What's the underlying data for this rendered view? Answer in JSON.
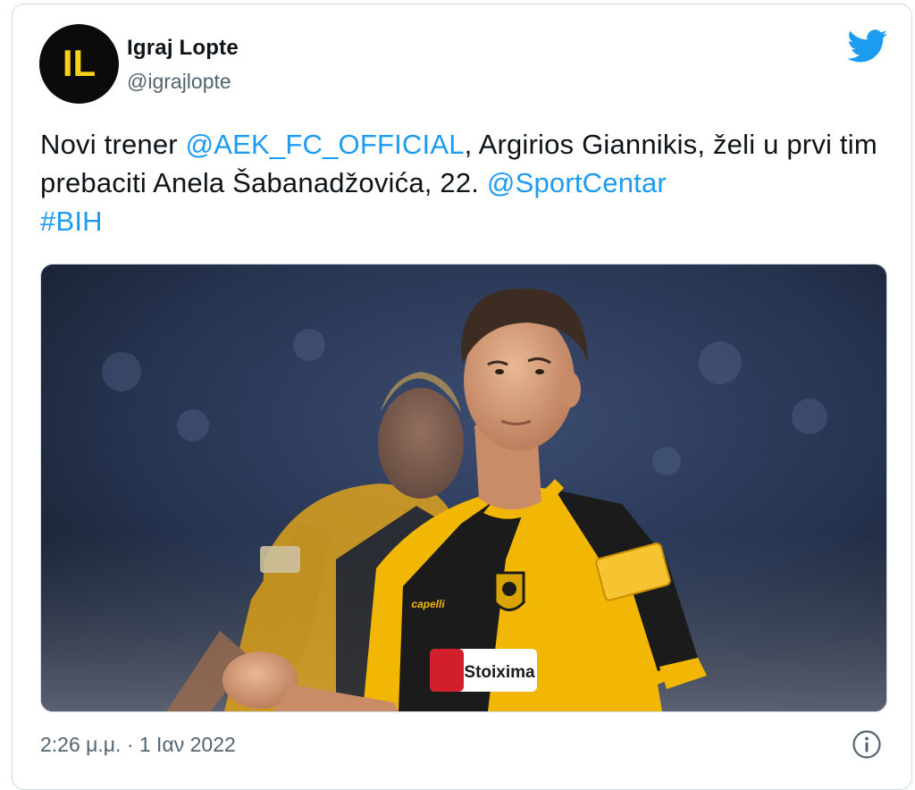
{
  "author": {
    "display_name": "Igraj Lopte",
    "handle": "@igrajlopte",
    "avatar_text": "IL"
  },
  "tweet": {
    "text_1": "Novi trener ",
    "mention_1": "@AEK_FC_OFFICIAL",
    "text_2": ", Argirios Giannikis, želi u prvi tim prebaciti Anela Šabanadžovića, 22. ",
    "mention_2": "@SportCentar",
    "hashtag": "#BIH"
  },
  "media": {
    "shirt_sponsor": "Stoixima",
    "kit_brand": "capelli"
  },
  "footer": {
    "timestamp": "2:26 μ.μ. · 1 Ιαν 2022"
  },
  "icons": {
    "brand": "twitter-bird-icon",
    "info": "info-icon"
  },
  "colors": {
    "link": "#1d9bf0",
    "brand": "#1d9bf0",
    "secondary_text": "#536471",
    "avatar_letters": "#f7d117",
    "kit_yellow": "#f2b705"
  }
}
